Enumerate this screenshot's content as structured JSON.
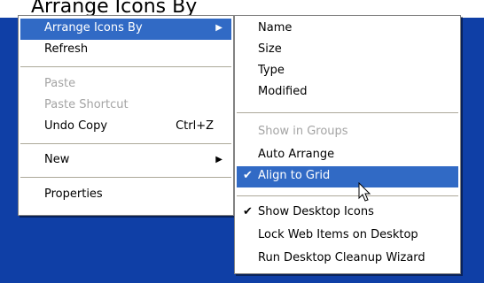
{
  "caption": "Arrange Icons By",
  "context_menu": {
    "items": [
      {
        "label": "Arrange Icons By"
      },
      {
        "label": "Refresh"
      },
      {
        "label": "Paste"
      },
      {
        "label": "Paste Shortcut"
      },
      {
        "label": "Undo Copy",
        "shortcut": "Ctrl+Z"
      },
      {
        "label": "New"
      },
      {
        "label": "Properties"
      }
    ]
  },
  "arrange_submenu": {
    "items": [
      {
        "label": "Name"
      },
      {
        "label": "Size"
      },
      {
        "label": "Type"
      },
      {
        "label": "Modified"
      },
      {
        "label": "Show in Groups"
      },
      {
        "label": "Auto Arrange"
      },
      {
        "label": "Align to Grid"
      },
      {
        "label": "Show Desktop Icons"
      },
      {
        "label": "Lock Web Items on Desktop"
      },
      {
        "label": "Run Desktop Cleanup Wizard"
      }
    ]
  },
  "icons": {
    "submenu_arrow": "triangle-right-icon",
    "check": "checkmark-icon",
    "cursor": "arrow-pointer-icon"
  },
  "colors": {
    "desktop": "#0F3FA6",
    "highlight": "#316AC5",
    "disabled_text": "#a4a4a4"
  }
}
